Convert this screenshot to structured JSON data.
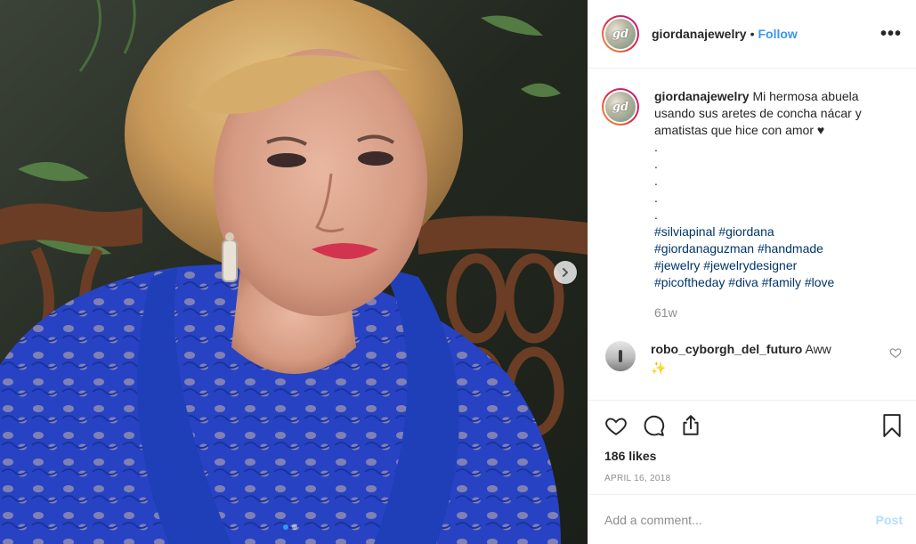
{
  "post": {
    "username": "giordanajewelry",
    "separator": "•",
    "follow_label": "Follow",
    "more_label": "•••",
    "avatar_monogram": "gd",
    "caption_text": "Mi hermosa abuela usando sus aretes de concha nácar y amatistas que hice con amor ♥",
    "caption_dots": [
      ".",
      ".",
      ".",
      ".",
      "."
    ],
    "hashtags_line1": "#silviapinal #giordana",
    "hashtags_line2": "#giordanaguzman #handmade",
    "hashtags_line3": "#jewelry #jewelrydesigner",
    "hashtags_line4": "#picoftheday #diva #family #love",
    "time_ago": "61w",
    "comment": {
      "username": "robo_cyborgh_del_futuro",
      "text": "Aww",
      "emoji": "✨"
    },
    "likes": "186 likes",
    "date": "APRIL 16, 2018",
    "add_comment_placeholder": "Add a comment...",
    "post_label": "Post"
  },
  "carousel": {
    "slide_count": 2,
    "active_index": 0
  },
  "colors": {
    "link_blue": "#3897f0",
    "hashtag_blue": "#003569",
    "muted_gray": "#8e8e8e",
    "post_disabled": "#b2dffc",
    "dress_blue": "#1f3fb8"
  },
  "icons": {
    "header": "more-options-icon",
    "carousel_next": "chevron-right-icon",
    "actions": [
      "heart-icon",
      "comment-icon",
      "share-icon",
      "bookmark-icon"
    ]
  }
}
